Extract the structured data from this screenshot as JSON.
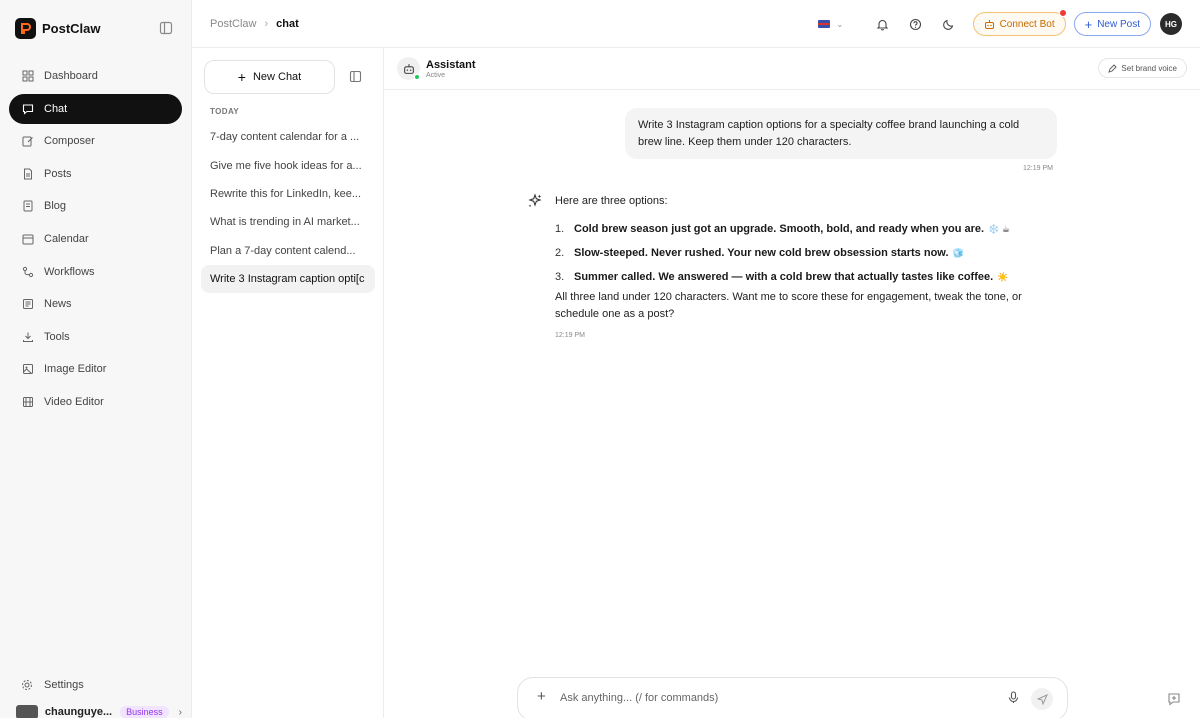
{
  "app": {
    "name": "PostClaw"
  },
  "sidebar": {
    "items": [
      {
        "label": "Dashboard",
        "icon": "grid-icon",
        "active": false
      },
      {
        "label": "Chat",
        "icon": "chat-icon",
        "active": true
      },
      {
        "label": "Composer",
        "icon": "edit-icon",
        "active": false
      },
      {
        "label": "Posts",
        "icon": "file-icon",
        "active": false
      },
      {
        "label": "Blog",
        "icon": "document-icon",
        "active": false
      },
      {
        "label": "Calendar",
        "icon": "calendar-icon",
        "active": false
      },
      {
        "label": "Workflows",
        "icon": "workflow-icon",
        "active": false
      },
      {
        "label": "News",
        "icon": "newspaper-icon",
        "active": false
      },
      {
        "label": "Tools",
        "icon": "download-icon",
        "active": false
      },
      {
        "label": "Image Editor",
        "icon": "image-icon",
        "active": false
      },
      {
        "label": "Video Editor",
        "icon": "film-icon",
        "active": false
      }
    ],
    "settings_label": "Settings",
    "user": {
      "name": "chaunguye...",
      "plan": "Business"
    }
  },
  "header": {
    "breadcrumb_root": "PostClaw",
    "breadcrumb_current": "chat",
    "connect_bot_label": "Connect Bot",
    "new_post_label": "New Post",
    "avatar_initials": "HG"
  },
  "chatlist": {
    "new_chat_label": "New Chat",
    "section_label": "TODAY",
    "items": [
      {
        "title": "7-day content calendar for a ...",
        "active": false
      },
      {
        "title": "Give me five hook ideas for a...",
        "active": false
      },
      {
        "title": "Rewrite this for LinkedIn, kee...",
        "active": false
      },
      {
        "title": "What is trending in AI market...",
        "active": false
      },
      {
        "title": "Plan a 7-day content calend...",
        "active": false
      },
      {
        "title": "Write 3 Instagram caption opti[c",
        "active": true
      }
    ]
  },
  "chat": {
    "assistant_name": "Assistant",
    "assistant_status": "Active",
    "brand_voice_label": "Set brand voice",
    "user_message": "Write 3 Instagram caption options for a specialty coffee brand launching a cold brew line. Keep them under 120 characters.",
    "user_time": "12:19 PM",
    "reply_intro": "Here are three options:",
    "reply_options": [
      {
        "num": "1.",
        "text": "Cold brew season just got an upgrade. Smooth, bold, and ready when you are.",
        "emoji": "❄️ ☕"
      },
      {
        "num": "2.",
        "text": "Slow-steeped. Never rushed. Your new cold brew obsession starts now.",
        "emoji": "🧊"
      },
      {
        "num": "3.",
        "text": "Summer called. We answered — with a cold brew that actually tastes like coffee.",
        "emoji": "☀️"
      }
    ],
    "reply_outro": "All three land under 120 characters. Want me to score these for engagement, tweak the tone, or schedule one as a post?",
    "reply_time": "12:19 PM"
  },
  "composer": {
    "placeholder": "Ask anything... (/ for commands)"
  }
}
